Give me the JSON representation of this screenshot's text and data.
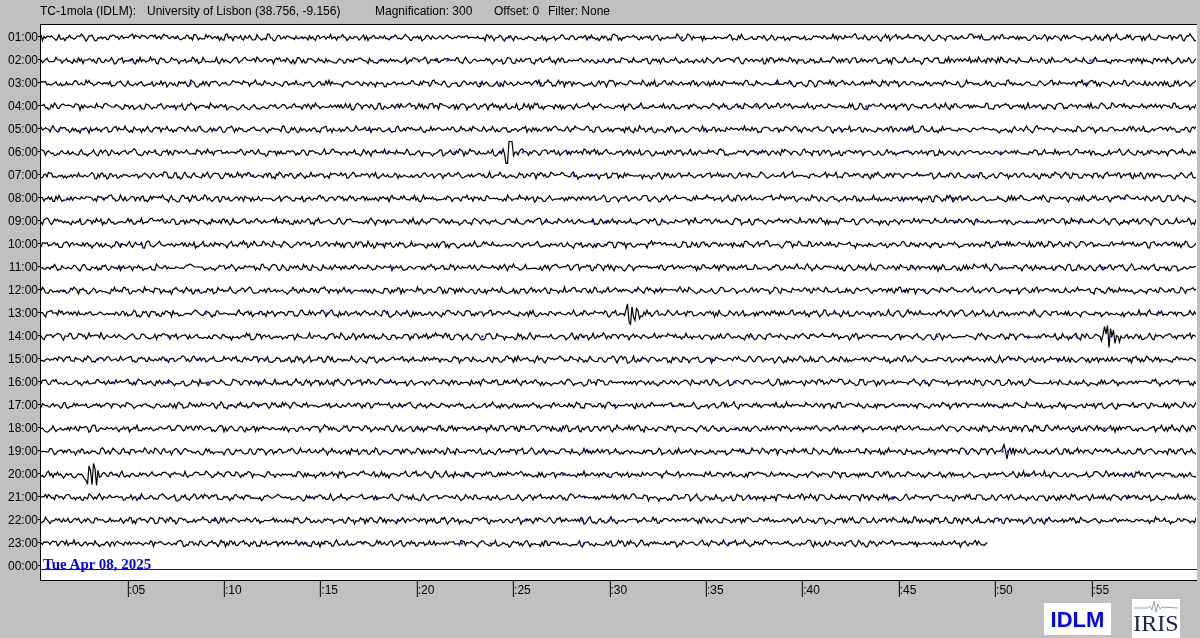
{
  "header": {
    "station": "TC-1mola (IDLM):",
    "location": "University of Lisbon (38.756, -9.156)",
    "magnification": "Magnification: 300",
    "offset": "Offset: 0",
    "filter": "Filter: None"
  },
  "rows": [
    {
      "label": "01:00",
      "kind": "trace",
      "level": 1
    },
    {
      "label": "02:00",
      "kind": "trace",
      "level": 1
    },
    {
      "label": "03:00",
      "kind": "trace",
      "level": 1
    },
    {
      "label": "04:00",
      "kind": "trace",
      "level": 1
    },
    {
      "label": "05:00",
      "kind": "trace",
      "level": 1
    },
    {
      "label": "06:00",
      "kind": "trace",
      "level": 1
    },
    {
      "label": "07:00",
      "kind": "trace",
      "level": 1
    },
    {
      "label": "08:00",
      "kind": "trace",
      "level": 1
    },
    {
      "label": "09:00",
      "kind": "trace",
      "level": 1
    },
    {
      "label": "10:00",
      "kind": "trace",
      "level": 1
    },
    {
      "label": "11:00",
      "kind": "trace",
      "level": 1
    },
    {
      "label": "12:00",
      "kind": "trace",
      "level": 1
    },
    {
      "label": "13:00",
      "kind": "trace",
      "level": 1
    },
    {
      "label": "14:00",
      "kind": "trace",
      "level": 1
    },
    {
      "label": "15:00",
      "kind": "trace",
      "level": 1
    },
    {
      "label": "16:00",
      "kind": "trace",
      "level": 1
    },
    {
      "label": "17:00",
      "kind": "trace",
      "level": 1
    },
    {
      "label": "18:00",
      "kind": "trace",
      "level": 1
    },
    {
      "label": "19:00",
      "kind": "trace",
      "level": 1
    },
    {
      "label": "20:00",
      "kind": "trace",
      "level": 1
    },
    {
      "label": "21:00",
      "kind": "trace",
      "level": 1
    },
    {
      "label": "22:00",
      "kind": "trace",
      "level": 1
    },
    {
      "label": "23:00",
      "kind": "trace",
      "level": 0.82
    },
    {
      "label": "00:00",
      "kind": "current",
      "date": "Tue Apr 08, 2025"
    }
  ],
  "x_ticks": [
    ":05",
    ":10",
    ":15",
    ":20",
    ":25",
    ":30",
    ":35",
    ":40",
    ":45",
    ":50",
    ":55"
  ],
  "logos": {
    "station": "IDLM",
    "network": "IRIS"
  }
}
